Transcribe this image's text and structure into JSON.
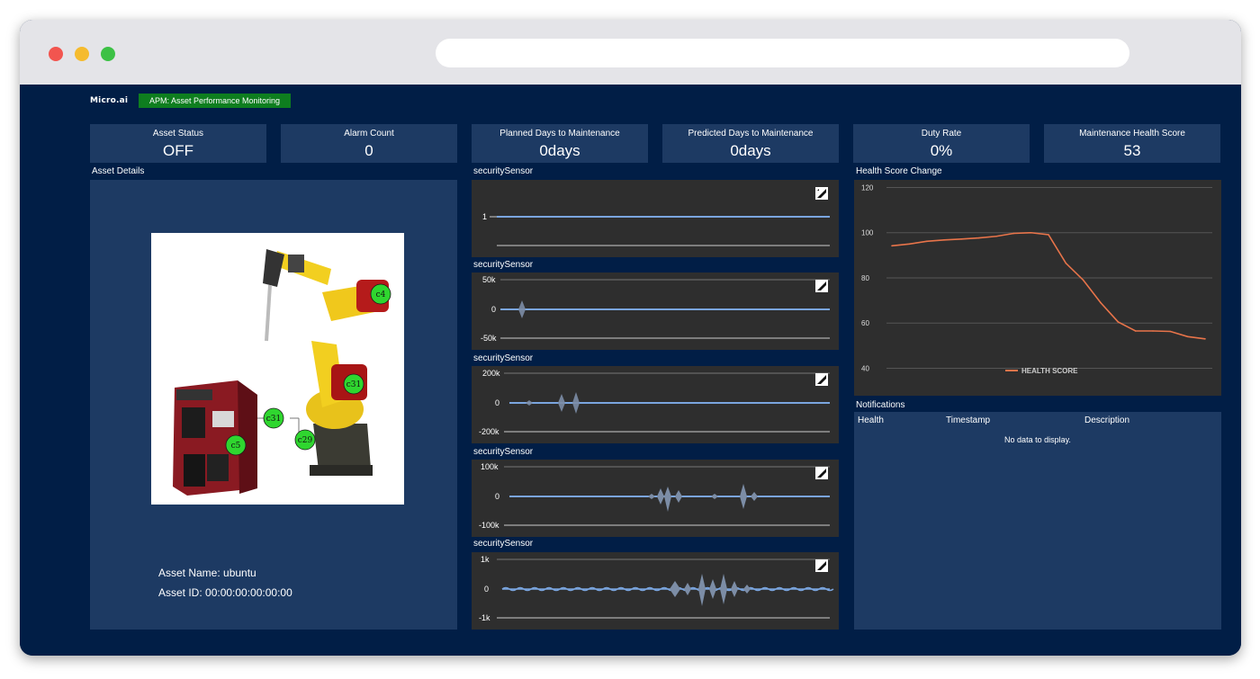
{
  "app": {
    "logo_text": "Micro.ai",
    "badge": "APM: Asset Performance Monitoring"
  },
  "kpis": [
    {
      "label": "Asset Status",
      "value": "OFF"
    },
    {
      "label": "Alarm Count",
      "value": "0"
    },
    {
      "label": "Planned Days to Maintenance",
      "value": "0days"
    },
    {
      "label": "Predicted Days to Maintenance",
      "value": "0days"
    },
    {
      "label": "Duty Rate",
      "value": "0%"
    },
    {
      "label": "Maintenance Health Score",
      "value": "53"
    }
  ],
  "asset_details": {
    "title": "Asset Details",
    "name_line": "Asset Name: ubuntu",
    "id_line": "Asset ID: 00:00:00:00:00:00",
    "diagram_labels": [
      "c4",
      "c31",
      "c31",
      "c29",
      "c5"
    ]
  },
  "sensor_charts": [
    {
      "title": "securitySensor",
      "ticks": [
        "1"
      ]
    },
    {
      "title": "securitySensor",
      "ticks": [
        "50k",
        "0",
        "-50k"
      ]
    },
    {
      "title": "securitySensor",
      "ticks": [
        "200k",
        "0",
        "-200k"
      ]
    },
    {
      "title": "securitySensor",
      "ticks": [
        "100k",
        "0",
        "-100k"
      ]
    },
    {
      "title": "securitySensor",
      "ticks": [
        "1k",
        "0",
        "-1k"
      ]
    }
  ],
  "health_chart": {
    "title": "Health Score Change",
    "legend": "HEALTH SCORE",
    "line_color": "#e8744a"
  },
  "chart_data": {
    "type": "line",
    "title": "Health Score Change",
    "y_ticks": [
      120,
      100,
      80,
      60,
      40
    ],
    "ylim": [
      35,
      121
    ],
    "series": [
      {
        "name": "HEALTH SCORE",
        "values": [
          94.2,
          95,
          96.2,
          96.8,
          97.2,
          97.7,
          98.4,
          99.7,
          100,
          99.1,
          86.5,
          79,
          69,
          60.5,
          56.5,
          56.5,
          56.3,
          54,
          53
        ]
      }
    ],
    "grid": true,
    "legend_position": "bottom-center"
  },
  "notifications": {
    "title": "Notifications",
    "columns": [
      "Health",
      "Timestamp",
      "Description"
    ],
    "empty_text": "No data to display."
  },
  "colors": {
    "background": "#011e46",
    "panel": "#1d3a63",
    "chart_bg": "#2e2e2e",
    "sensor_line": "#7aa5df",
    "badge": "#0e7e1f"
  }
}
